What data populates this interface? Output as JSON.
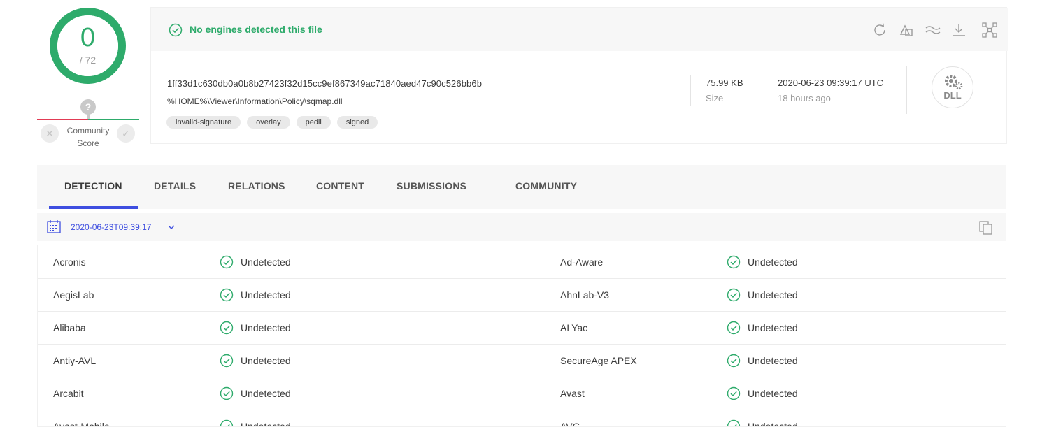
{
  "score": {
    "detected": "0",
    "total": "/ 72",
    "ring_color": "#2eab6b"
  },
  "community": {
    "label_line1": "Community",
    "label_line2": "Score",
    "unknown_glyph": "?"
  },
  "summary": {
    "status_text": "No engines detected this file",
    "hash": "1ff33d1c630db0a0b8b27423f32d15cc9ef867349ac71840aed47c90c526bb6b",
    "path": "%HOME%\\Viewer\\Information\\Policy\\sqmap.dll",
    "tags": [
      "invalid-signature",
      "overlay",
      "pedll",
      "signed"
    ],
    "size_value": "75.99 KB",
    "size_label": "Size",
    "date_value": "2020-06-23 09:39:17 UTC",
    "date_ago": "18 hours ago",
    "file_type": "DLL",
    "toolbar_icons": [
      "reanalyze-icon",
      "similar-icon",
      "compare-icon",
      "download-icon",
      "graph-icon"
    ]
  },
  "tabs": [
    {
      "label": "DETECTION",
      "active": true
    },
    {
      "label": "DETAILS"
    },
    {
      "label": "RELATIONS"
    },
    {
      "label": "CONTENT"
    },
    {
      "label": "SUBMISSIONS"
    },
    {
      "label": "COMMUNITY"
    }
  ],
  "analysis_date": "2020-06-23T09:39:17",
  "results": [
    {
      "left_engine": "Acronis",
      "left_result": "Undetected",
      "right_engine": "Ad-Aware",
      "right_result": "Undetected"
    },
    {
      "left_engine": "AegisLab",
      "left_result": "Undetected",
      "right_engine": "AhnLab-V3",
      "right_result": "Undetected"
    },
    {
      "left_engine": "Alibaba",
      "left_result": "Undetected",
      "right_engine": "ALYac",
      "right_result": "Undetected"
    },
    {
      "left_engine": "Antiy-AVL",
      "left_result": "Undetected",
      "right_engine": "SecureAge APEX",
      "right_result": "Undetected"
    },
    {
      "left_engine": "Arcabit",
      "left_result": "Undetected",
      "right_engine": "Avast",
      "right_result": "Undetected"
    },
    {
      "left_engine": "Avast-Mobile",
      "left_result": "Undetected",
      "right_engine": "AVG",
      "right_result": "Undetected"
    }
  ],
  "colors": {
    "clean": "#2eab6b",
    "accent": "#3e4ee0",
    "malicious": "#e23b55"
  }
}
